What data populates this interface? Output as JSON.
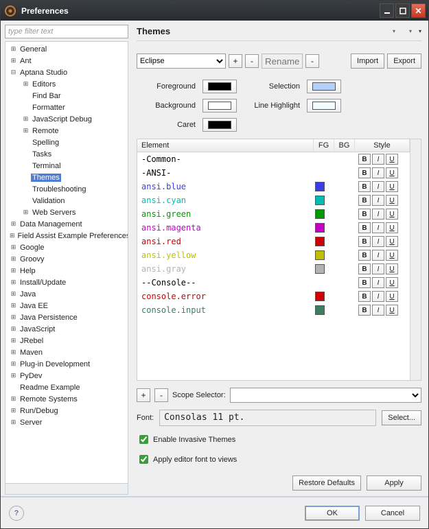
{
  "window": {
    "title": "Preferences"
  },
  "filter_placeholder": "type filter text",
  "right": {
    "title": "Themes",
    "theme_selected": "Eclipse",
    "rename_placeholder": "Rename",
    "import_btn": "Import",
    "export_btn": "Export",
    "labels": {
      "foreground": "Foreground",
      "background": "Background",
      "caret": "Caret",
      "selection": "Selection",
      "line_highlight": "Line Highlight",
      "scope_selector": "Scope Selector:",
      "font": "Font:",
      "select_btn": "Select...",
      "enable_invasive": "Enable Invasive Themes",
      "apply_font": "Apply editor font to views",
      "restore_defaults": "Restore Defaults",
      "apply": "Apply",
      "ok": "OK",
      "cancel": "Cancel"
    },
    "swatches": {
      "foreground": "#000000",
      "background": "#ffffff",
      "caret": "#000000",
      "selection": "#b3cffc",
      "line_highlight": "#f4fbff"
    },
    "font_value": "Consolas 11 pt.",
    "table": {
      "head": {
        "element": "Element",
        "fg": "FG",
        "bg": "BG",
        "style": "Style"
      },
      "rows": [
        {
          "label": "-Common-",
          "color": "#000000",
          "fg": null
        },
        {
          "label": "-ANSI-",
          "color": "#000000",
          "fg": null
        },
        {
          "label": "ansi.blue",
          "color": "#3d3de6",
          "fg": "#3d3de6"
        },
        {
          "label": "ansi.cyan",
          "color": "#00bdb4",
          "fg": "#00bdb4"
        },
        {
          "label": "ansi.green",
          "color": "#009800",
          "fg": "#009800"
        },
        {
          "label": "ansi.magenta",
          "color": "#c400c4",
          "fg": "#c400c4"
        },
        {
          "label": "ansi.red",
          "color": "#cc0000",
          "fg": "#cc0000"
        },
        {
          "label": "ansi.yellow",
          "color": "#c0c000",
          "fg": "#c0c000"
        },
        {
          "label": "ansi.gray",
          "color": "#b3b3b3",
          "fg": "#b3b3b3"
        },
        {
          "label": "--Console--",
          "color": "#000000",
          "fg": null
        },
        {
          "label": "console.error",
          "color": "#cc0000",
          "fg": "#cc0000"
        },
        {
          "label": "console.input",
          "color": "#3e7c5f",
          "fg": "#3e7c5f"
        }
      ]
    }
  },
  "tree": [
    {
      "label": "General",
      "depth": 0,
      "expand": "plus"
    },
    {
      "label": "Ant",
      "depth": 0,
      "expand": "plus"
    },
    {
      "label": "Aptana Studio",
      "depth": 0,
      "expand": "minus"
    },
    {
      "label": "Editors",
      "depth": 1,
      "expand": "plus"
    },
    {
      "label": "Find Bar",
      "depth": 1,
      "expand": "none"
    },
    {
      "label": "Formatter",
      "depth": 1,
      "expand": "none"
    },
    {
      "label": "JavaScript Debug",
      "depth": 1,
      "expand": "plus"
    },
    {
      "label": "Remote",
      "depth": 1,
      "expand": "plus"
    },
    {
      "label": "Spelling",
      "depth": 1,
      "expand": "none"
    },
    {
      "label": "Tasks",
      "depth": 1,
      "expand": "none"
    },
    {
      "label": "Terminal",
      "depth": 1,
      "expand": "none"
    },
    {
      "label": "Themes",
      "depth": 1,
      "expand": "none",
      "selected": true
    },
    {
      "label": "Troubleshooting",
      "depth": 1,
      "expand": "none"
    },
    {
      "label": "Validation",
      "depth": 1,
      "expand": "none"
    },
    {
      "label": "Web Servers",
      "depth": 1,
      "expand": "plus"
    },
    {
      "label": "Data Management",
      "depth": 0,
      "expand": "plus"
    },
    {
      "label": "Field Assist Example Preferences",
      "depth": 0,
      "expand": "plus"
    },
    {
      "label": "Google",
      "depth": 0,
      "expand": "plus"
    },
    {
      "label": "Groovy",
      "depth": 0,
      "expand": "plus"
    },
    {
      "label": "Help",
      "depth": 0,
      "expand": "plus"
    },
    {
      "label": "Install/Update",
      "depth": 0,
      "expand": "plus"
    },
    {
      "label": "Java",
      "depth": 0,
      "expand": "plus"
    },
    {
      "label": "Java EE",
      "depth": 0,
      "expand": "plus"
    },
    {
      "label": "Java Persistence",
      "depth": 0,
      "expand": "plus"
    },
    {
      "label": "JavaScript",
      "depth": 0,
      "expand": "plus"
    },
    {
      "label": "JRebel",
      "depth": 0,
      "expand": "plus"
    },
    {
      "label": "Maven",
      "depth": 0,
      "expand": "plus"
    },
    {
      "label": "Plug-in Development",
      "depth": 0,
      "expand": "plus"
    },
    {
      "label": "PyDev",
      "depth": 0,
      "expand": "plus"
    },
    {
      "label": "Readme Example",
      "depth": 0,
      "expand": "none"
    },
    {
      "label": "Remote Systems",
      "depth": 0,
      "expand": "plus"
    },
    {
      "label": "Run/Debug",
      "depth": 0,
      "expand": "plus"
    },
    {
      "label": "Server",
      "depth": 0,
      "expand": "plus"
    }
  ]
}
